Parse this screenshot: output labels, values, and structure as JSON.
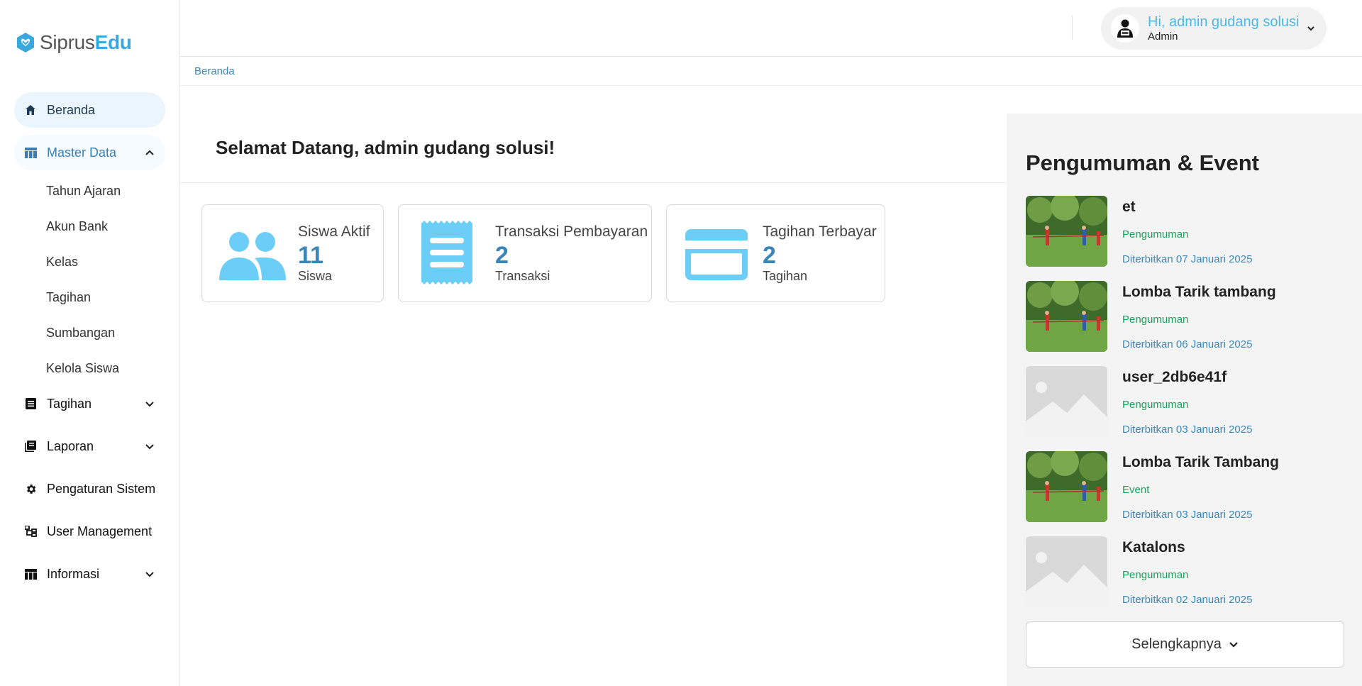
{
  "brand": {
    "part1": "Siprus",
    "part2": "Edu"
  },
  "sidebar": {
    "items": [
      {
        "label": "Beranda",
        "icon": "home-icon"
      },
      {
        "label": "Master Data",
        "icon": "table-icon"
      },
      {
        "label": "Tagihan",
        "icon": "receipt-icon"
      },
      {
        "label": "Laporan",
        "icon": "book-icon"
      },
      {
        "label": "Pengaturan Sistem",
        "icon": "gear-icon"
      },
      {
        "label": "User Management",
        "icon": "sitemap-icon"
      },
      {
        "label": "Informasi",
        "icon": "table-icon"
      }
    ],
    "master_data_sub": [
      "Tahun Ajaran",
      "Akun Bank",
      "Kelas",
      "Tagihan",
      "Sumbangan",
      "Kelola Siswa"
    ]
  },
  "topbar": {
    "greeting": "Hi, admin gudang solusi",
    "role": "Admin"
  },
  "breadcrumb": "Beranda",
  "welcome": "Selamat Datang, admin gudang solusi!",
  "stats": [
    {
      "title": "Siswa Aktif",
      "value": "11",
      "unit": "Siswa",
      "icon": "users-icon"
    },
    {
      "title": "Transaksi Pembayaran",
      "value": "2",
      "unit": "Transaksi",
      "icon": "receipt-icon"
    },
    {
      "title": "Tagihan Terbayar",
      "value": "2",
      "unit": "Tagihan",
      "icon": "credit-card-icon"
    }
  ],
  "panel": {
    "title": "Pengumuman & Event",
    "items": [
      {
        "title": "et",
        "category": "Pengumuman",
        "date": "Diterbitkan 07 Januari 2025",
        "image": "photo"
      },
      {
        "title": "Lomba Tarik tambang",
        "category": "Pengumuman",
        "date": "Diterbitkan 06 Januari 2025",
        "image": "photo"
      },
      {
        "title": "user_2db6e41f",
        "category": "Pengumuman",
        "date": "Diterbitkan 03 Januari 2025",
        "image": "placeholder"
      },
      {
        "title": "Lomba Tarik Tambang",
        "category": "Event",
        "date": "Diterbitkan 03 Januari 2025",
        "image": "photo"
      },
      {
        "title": "Katalons",
        "category": "Pengumuman",
        "date": "Diterbitkan 02 Januari 2025",
        "image": "placeholder"
      }
    ],
    "more_label": "Selengkapnya"
  },
  "colors": {
    "accent": "#4cb8ea",
    "accent_dark": "#3a86b9",
    "success": "#1aa15a",
    "icon_blue": "#6ccdf6"
  }
}
